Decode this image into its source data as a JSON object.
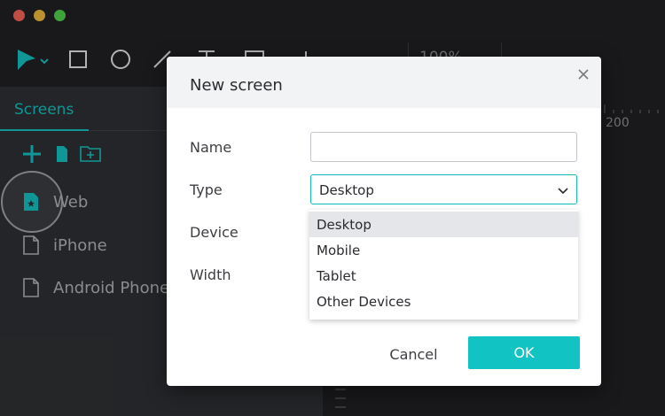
{
  "toolbar": {
    "zoom_value": "100%",
    "tools": [
      "select-tool",
      "rectangle-tool",
      "ellipse-tool",
      "line-tool",
      "text-tool",
      "image-tool",
      "more-tool"
    ]
  },
  "left_panel": {
    "tab_label": "Screens",
    "screens": [
      {
        "label": "Web",
        "icon": "starred-page-icon"
      },
      {
        "label": "iPhone",
        "icon": "page-icon"
      },
      {
        "label": "Android Phone",
        "icon": "page-icon"
      }
    ]
  },
  "canvas": {
    "ruler_label": "200"
  },
  "dialog": {
    "title": "New screen",
    "labels": {
      "name": "Name",
      "type": "Type",
      "device": "Device",
      "width": "Width"
    },
    "name_value": "",
    "type_value": "Desktop",
    "type_options": [
      "Desktop",
      "Mobile",
      "Tablet",
      "Other Devices"
    ],
    "cancel_label": "Cancel",
    "ok_label": "OK"
  },
  "colors": {
    "accent": "#14b8b7",
    "ok_button": "#11c3c3",
    "panel_bg": "#2d2e31",
    "window_bg": "#1f1f21"
  }
}
